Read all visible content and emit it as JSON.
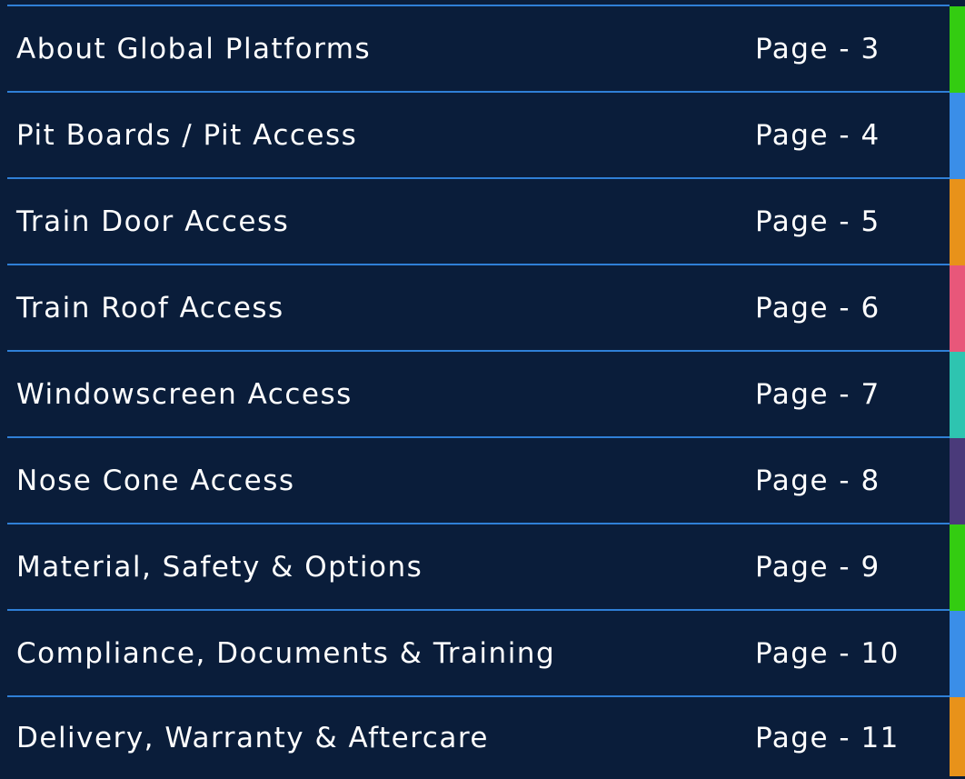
{
  "toc": {
    "items": [
      {
        "title": "About Global Platforms",
        "page": "Page - 3",
        "tab_color": "#33cc11"
      },
      {
        "title": "Pit Boards / Pit Access",
        "page": "Page - 4",
        "tab_color": "#3a8ee8"
      },
      {
        "title": "Train Door Access",
        "page": "Page - 5",
        "tab_color": "#e8921a"
      },
      {
        "title": "Train Roof  Access",
        "page": "Page - 6",
        "tab_color": "#e8577a"
      },
      {
        "title": "Windowscreen Access",
        "page": "Page - 7",
        "tab_color": "#2ec4b0"
      },
      {
        "title": "Nose Cone Access",
        "page": "Page - 8",
        "tab_color": "#4a3a7a"
      },
      {
        "title": "Material, Safety & Options",
        "page": "Page - 9",
        "tab_color": "#33cc11"
      },
      {
        "title": "Compliance, Documents & Training",
        "page": "Page - 10",
        "tab_color": "#3a8ee8"
      },
      {
        "title": "Delivery, Warranty & Aftercare",
        "page": "Page - 11",
        "tab_color": "#e8921a"
      }
    ],
    "colors": {
      "background": "#0a1d3a",
      "divider": "#2f7fd6",
      "text": "#ffffff"
    }
  }
}
